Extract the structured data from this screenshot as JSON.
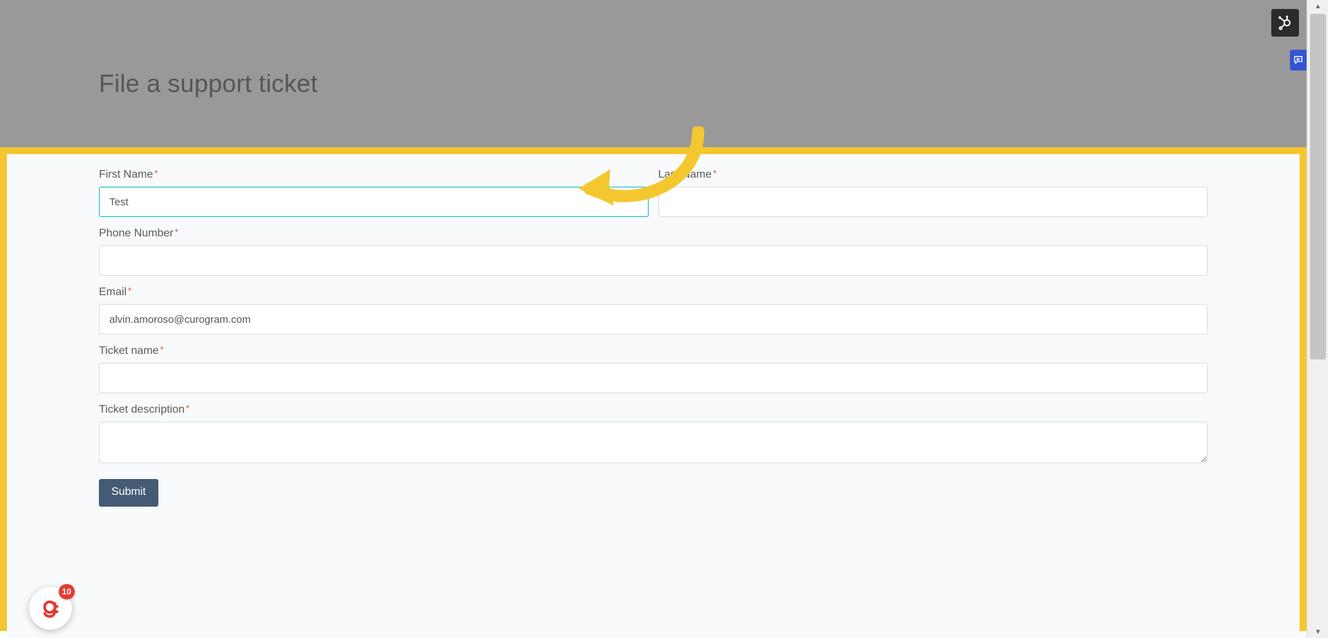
{
  "colors": {
    "highlight": "#f4c730",
    "focus_border": "#27c1c9",
    "submit_bg": "#455a74",
    "required": "#e74c3c"
  },
  "header": {
    "title": "File a support ticket"
  },
  "form": {
    "first_name": {
      "label": "First Name",
      "value": "Test"
    },
    "last_name": {
      "label": "Last Name",
      "value": ""
    },
    "phone": {
      "label": "Phone Number",
      "value": ""
    },
    "email": {
      "label": "Email",
      "value": "alvin.amoroso@curogram.com"
    },
    "ticket_name": {
      "label": "Ticket name",
      "value": ""
    },
    "ticket_desc": {
      "label": "Ticket description",
      "value": ""
    },
    "submit_label": "Submit"
  },
  "widgets": {
    "g_badge_count": "10"
  },
  "icons": {
    "hubspot": "hubspot-icon",
    "chat": "chat-icon",
    "g": "g-icon",
    "scroll_up": "▲",
    "scroll_down": "▼"
  }
}
